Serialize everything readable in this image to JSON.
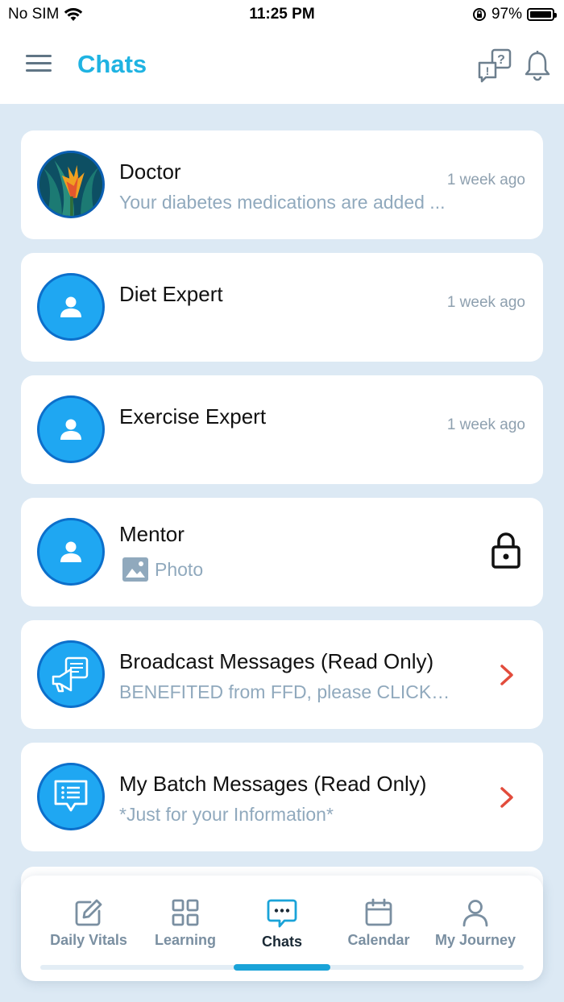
{
  "status_bar": {
    "carrier": "No SIM",
    "time": "11:25 PM",
    "battery": "97%"
  },
  "header": {
    "title": "Chats"
  },
  "chats": [
    {
      "name": "Doctor",
      "preview": "Your diabetes medications are added ...",
      "time": "1 week ago"
    },
    {
      "name": "Diet Expert",
      "preview": "",
      "time": "1 week ago"
    },
    {
      "name": "Exercise Expert",
      "preview": "",
      "time": "1 week ago"
    },
    {
      "name": "Mentor",
      "preview": "Photo",
      "time": ""
    },
    {
      "name": "Broadcast Messages (Read Only)",
      "preview": "BENEFITED from FFD, please CLICK on th...",
      "time": ""
    },
    {
      "name": "My Batch Messages (Read Only)",
      "preview": "*Just for your Information*",
      "time": ""
    }
  ],
  "tabs": [
    {
      "label": "Daily Vitals",
      "icon": "edit-icon"
    },
    {
      "label": "Learning",
      "icon": "grid-icon"
    },
    {
      "label": "Chats",
      "icon": "chat-icon",
      "active": true
    },
    {
      "label": "Calendar",
      "icon": "calendar-icon"
    },
    {
      "label": "My Journey",
      "icon": "user-icon"
    }
  ],
  "colors": {
    "accent": "#1fb3e2",
    "avatar": "#1fa7f2",
    "chevron": "#e24c3c",
    "background": "#dce9f4"
  }
}
